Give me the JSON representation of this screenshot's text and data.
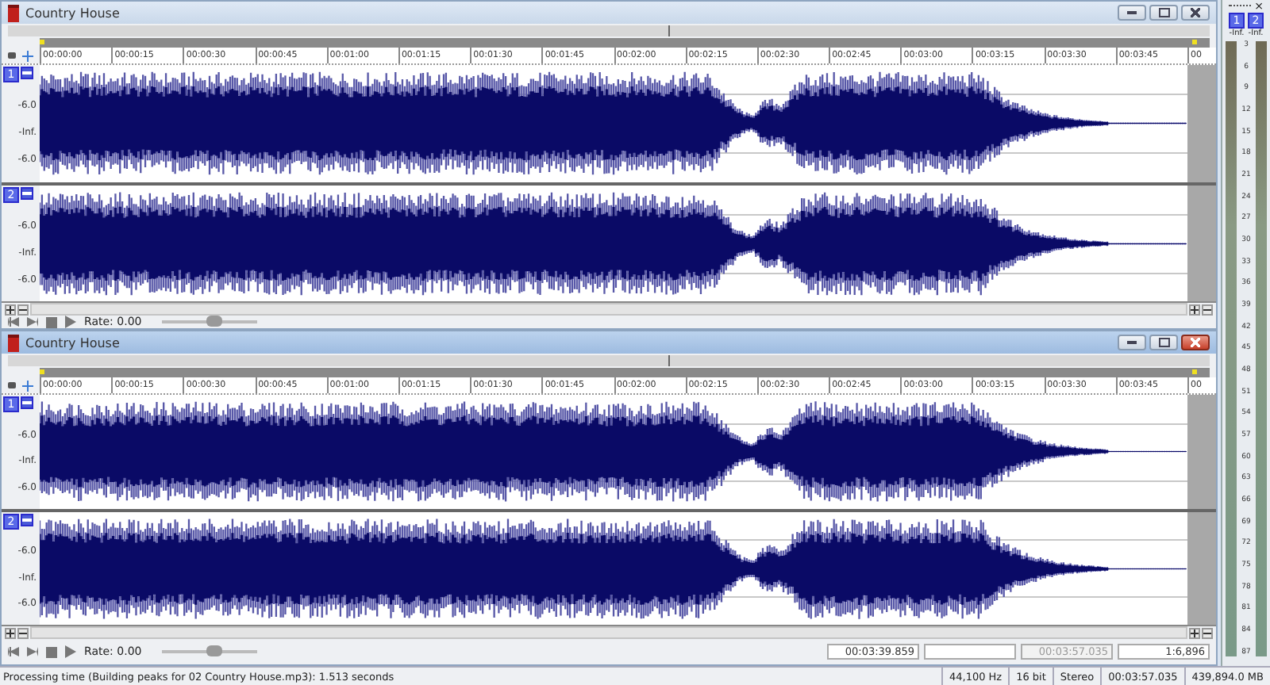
{
  "windows": [
    {
      "title": "Country House",
      "active": false,
      "ruler_labels": [
        "00:00:00",
        "00:00:15",
        "00:00:30",
        "00:00:45",
        "00:01:00",
        "00:01:15",
        "00:01:30",
        "00:01:45",
        "00:02:00",
        "00:02:15",
        "00:02:30",
        "00:02:45",
        "00:03:00",
        "00:03:15",
        "00:03:30",
        "00:03:45"
      ],
      "ruler_end": "00",
      "tracks": [
        {
          "channel": "1",
          "db_labels": [
            "-6.0",
            "-Inf.",
            "-6.0"
          ]
        },
        {
          "channel": "2",
          "db_labels": [
            "-6.0",
            "-Inf.",
            "-6.0"
          ]
        }
      ],
      "transport": {
        "rate": "Rate: 0.00"
      }
    },
    {
      "title": "Country House",
      "active": true,
      "ruler_labels": [
        "00:00:00",
        "00:00:15",
        "00:00:30",
        "00:00:45",
        "00:01:00",
        "00:01:15",
        "00:01:30",
        "00:01:45",
        "00:02:00",
        "00:02:15",
        "00:02:30",
        "00:02:45",
        "00:03:00",
        "00:03:15",
        "00:03:30",
        "00:03:45"
      ],
      "ruler_end": "00",
      "tracks": [
        {
          "channel": "1",
          "db_labels": [
            "-6.0",
            "-Inf.",
            "-6.0"
          ]
        },
        {
          "channel": "2",
          "db_labels": [
            "-6.0",
            "-Inf.",
            "-6.0"
          ]
        }
      ],
      "transport": {
        "rate": "Rate: 0.00",
        "fields": [
          {
            "value": "00:03:39.859",
            "disabled": false
          },
          {
            "disabled": false
          },
          {
            "value": "00:03:57.035",
            "disabled": true
          },
          {
            "value": "1:6,896",
            "disabled": false
          }
        ]
      }
    }
  ],
  "meter": {
    "close": "×",
    "channels": [
      {
        "label": "1",
        "reading": "-Inf."
      },
      {
        "label": "2",
        "reading": "-Inf."
      }
    ],
    "scale": [
      "3",
      "6",
      "9",
      "12",
      "15",
      "18",
      "21",
      "24",
      "27",
      "30",
      "33",
      "36",
      "39",
      "42",
      "45",
      "48",
      "51",
      "54",
      "57",
      "60",
      "63",
      "66",
      "69",
      "72",
      "75",
      "78",
      "81",
      "84",
      "87"
    ]
  },
  "status_bar": {
    "message": "Processing time (Building peaks for 02 Country House.mp3): 1.513 seconds",
    "fields": [
      "44,100 Hz",
      "16 bit",
      "Stereo",
      "00:03:57.035",
      "439,894.0 MB"
    ]
  }
}
